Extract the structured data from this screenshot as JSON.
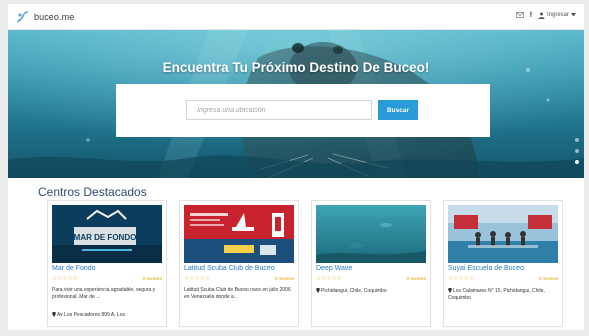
{
  "navbar": {
    "brand": "buceo.me",
    "login_label": "Ingresar",
    "facebook_glyph": "f",
    "icons": [
      "dive-logo-icon",
      "mail-icon",
      "facebook-icon",
      "user-icon",
      "caret-down-icon"
    ]
  },
  "hero": {
    "title": "Encuentra Tu Próximo Destino De Buceo!",
    "search_placeholder": "Ingresa una ubicación",
    "search_button": "Buscar",
    "slide_count": 3,
    "active_slide": 3
  },
  "section": {
    "title": "Centros Destacados"
  },
  "centers": [
    {
      "name": "Mar de Fondo",
      "rating": 0,
      "rating_max": 5,
      "reviews": "0 reviews",
      "description": "Para vivir una experiencia agradable, segura y profesional, Mar de ...",
      "location": "Av Los Pescadores 899 A, Los"
    },
    {
      "name": "Latitud Scuba Club de Buceo",
      "rating": 0,
      "rating_max": 5,
      "reviews": "0 reviews",
      "description": "Latitud Scuba Club de Buceo nace en julio 2006 en Venezuela donde a...",
      "location": ""
    },
    {
      "name": "Deep Wave",
      "rating": 0,
      "rating_max": 5,
      "reviews": "0 reviews",
      "description": "",
      "location": "Pichidangui, Chile, Coquimbo"
    },
    {
      "name": "Suyai Escuela de Buceo",
      "rating": 0,
      "rating_max": 5,
      "reviews": "0 reviews",
      "description": "",
      "location": "Los Calamares N° 15, Pichidangui, Chile, Coquimbo"
    }
  ],
  "colors": {
    "accent_blue": "#2a9bd8",
    "link_blue": "#2a7bc3",
    "heading_blue": "#2d4e73",
    "star_gold": "#f0b93a"
  }
}
